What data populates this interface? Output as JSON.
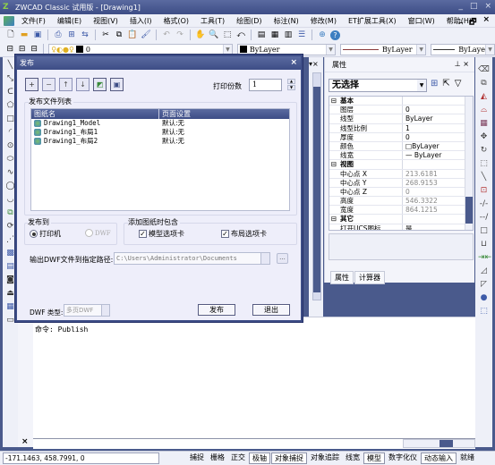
{
  "window": {
    "title": "ZWCAD Classic 试用版 - [Drawing1]",
    "controls": [
      "_",
      "□",
      "×"
    ]
  },
  "menu": {
    "items": [
      "文件(F)",
      "编辑(E)",
      "视图(V)",
      "插入(I)",
      "格式(O)",
      "工具(T)",
      "绘图(D)",
      "标注(N)",
      "修改(M)",
      "ET扩展工具(X)",
      "窗口(W)",
      "帮助(H)"
    ],
    "doc_controls": [
      "_",
      "🗗",
      "×"
    ]
  },
  "layerbar": {
    "layer": "0",
    "color": "ByLayer",
    "linetype": "ByLayer",
    "lineweight": "ByLayer"
  },
  "dialog": {
    "title": "发布",
    "close": "×",
    "copies_label": "打印份数",
    "copies_value": "1",
    "list_group_label": "发布文件列表",
    "columns": [
      "图纸名",
      "页面设置"
    ],
    "rows": [
      {
        "name": "Drawing1_Model",
        "setup": "默认:无"
      },
      {
        "name": "Drawing1_布局1",
        "setup": "默认:无"
      },
      {
        "name": "Drawing1_布局2",
        "setup": "默认:无"
      }
    ],
    "publish_to_label": "发布到",
    "radio_printer": "打印机",
    "radio_dwf": "DWF",
    "selected_target": "打印机",
    "include_label": "添加图纸时包含",
    "check_model": "模型选项卡",
    "check_layout": "布局选项卡",
    "check_model_checked": true,
    "check_layout_checked": true,
    "path_label": "输出DWF文件到指定路径:",
    "path_value": "C:\\Users\\Administrator\\Documents",
    "browse": "...",
    "dwf_type_label": "DWF 类型:",
    "dwf_type_value": "多页DWF",
    "publish_button": "发布",
    "exit_button": "退出"
  },
  "properties": {
    "title": "属性",
    "selection": "无选择",
    "rows": [
      {
        "type": "cat",
        "key": "基本",
        "value": ""
      },
      {
        "type": "row",
        "key": "图层",
        "value": "0"
      },
      {
        "type": "row",
        "key": "线型",
        "value": "ByLayer"
      },
      {
        "type": "row",
        "key": "线型比例",
        "value": "1"
      },
      {
        "type": "row",
        "key": "厚度",
        "value": "0"
      },
      {
        "type": "row",
        "key": "颜色",
        "value": "□ByLayer"
      },
      {
        "type": "row",
        "key": "线宽",
        "value": "— ByLayer"
      },
      {
        "type": "cat",
        "key": "视图",
        "value": ""
      },
      {
        "type": "gray",
        "key": "中心点 X",
        "value": "213.6181"
      },
      {
        "type": "gray",
        "key": "中心点 Y",
        "value": "268.9153"
      },
      {
        "type": "gray",
        "key": "中心点 Z",
        "value": "0"
      },
      {
        "type": "gray",
        "key": "高度",
        "value": "546.3322"
      },
      {
        "type": "gray",
        "key": "宽度",
        "value": "864.1215"
      },
      {
        "type": "cat",
        "key": "其它",
        "value": ""
      },
      {
        "type": "row",
        "key": "打开UCS图标",
        "value": "是"
      }
    ],
    "tabs": [
      "属性",
      "计算器"
    ]
  },
  "command": {
    "history": "命令: Publish",
    "close": "×"
  },
  "status": {
    "coords": "-171.1463,  458.7991,  0",
    "toggles": [
      {
        "label": "捕捉",
        "on": false
      },
      {
        "label": "栅格",
        "on": false
      },
      {
        "label": "正交",
        "on": false
      },
      {
        "label": "极轴",
        "on": true
      },
      {
        "label": "对象捕捉",
        "on": true
      },
      {
        "label": "对象追踪",
        "on": false
      },
      {
        "label": "线宽",
        "on": false
      },
      {
        "label": "模型",
        "on": true
      },
      {
        "label": "数字化仪",
        "on": false
      },
      {
        "label": "动态输入",
        "on": true
      },
      {
        "label": "就绪",
        "on": false
      }
    ]
  }
}
